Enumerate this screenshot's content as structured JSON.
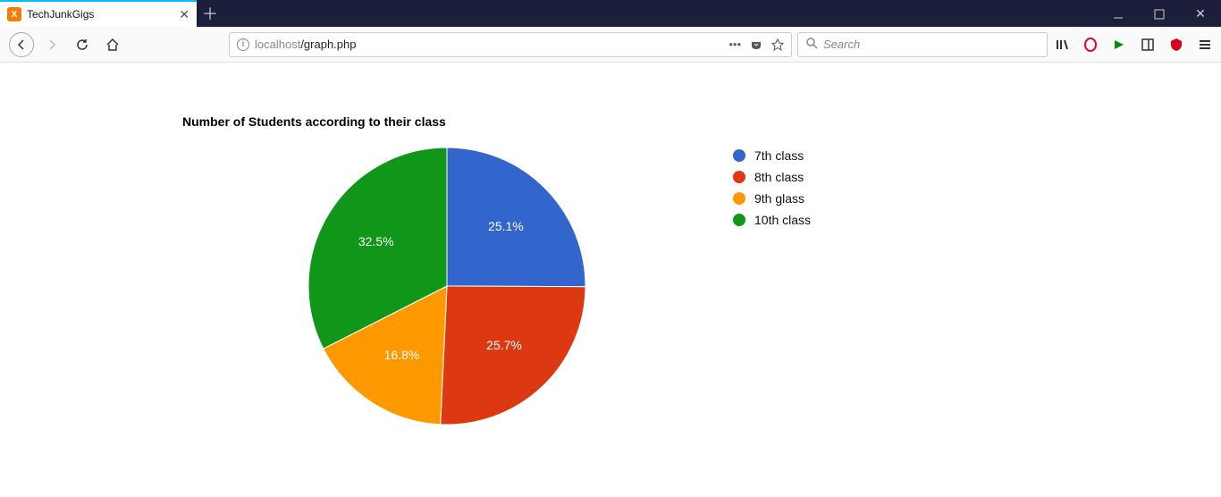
{
  "window": {
    "tab_title": "TechJunkGigs",
    "url_host": "localhost",
    "url_path": "/graph.php",
    "search_placeholder": "Search"
  },
  "chart_data": {
    "type": "pie",
    "title": "Number of Students according to their class",
    "series": [
      {
        "name": "7th class",
        "value": 25.1,
        "label": "25.1%",
        "color": "#3366cc"
      },
      {
        "name": "8th class",
        "value": 25.7,
        "label": "25.7%",
        "color": "#dc3912"
      },
      {
        "name": "9th glass",
        "value": 16.8,
        "label": "16.8%",
        "color": "#ff9900"
      },
      {
        "name": "10th class",
        "value": 32.5,
        "label": "32.5%",
        "color": "#109618"
      }
    ]
  }
}
